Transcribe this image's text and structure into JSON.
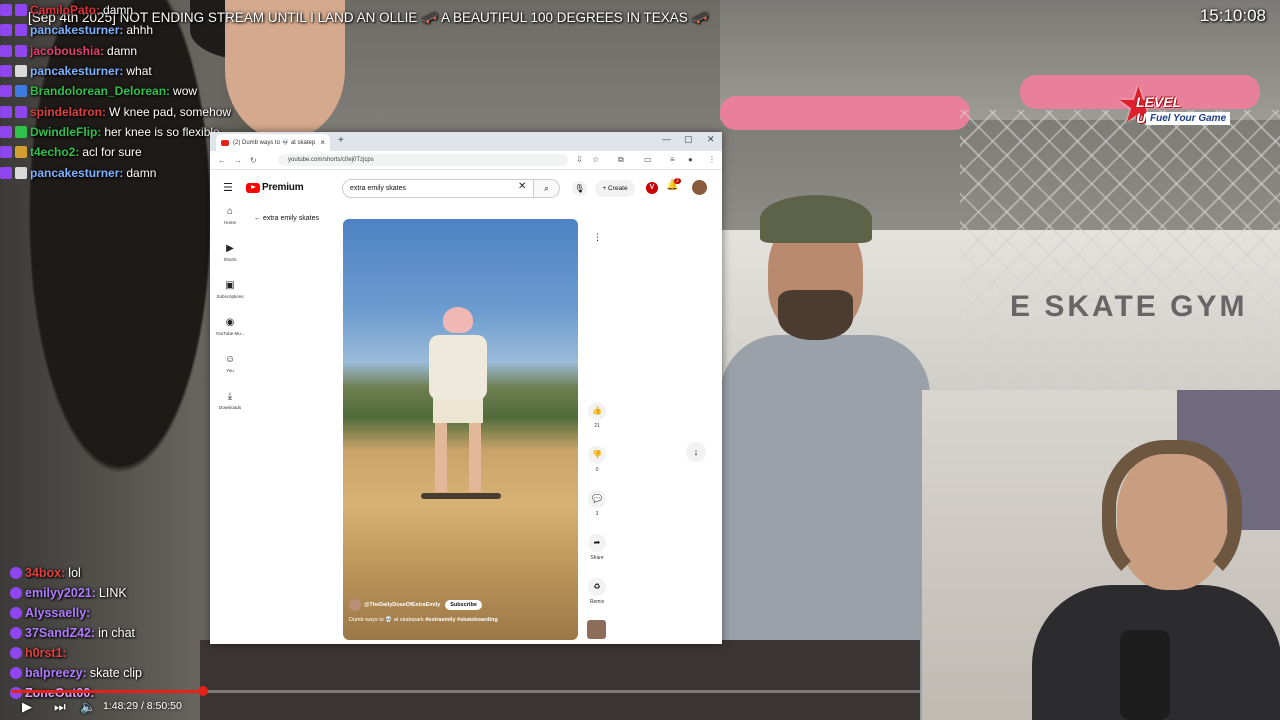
{
  "stream": {
    "title": "[Sep 4th 2025] NOT ENDING STREAM UNTIL I LAND AN OLLIE 🛹 A BEAUTIFUL 100 DEGREES IN TEXAS 🛹",
    "clock": "15:10:08",
    "logo_line1": "LEVEL UNLOCKED",
    "logo_line2": "Fuel Your Game",
    "gym_sign": "E SKATE GYM"
  },
  "chat_top": [
    {
      "user": "CamiloPato:",
      "msg": "damn",
      "color": "#e0303a",
      "badge": "b-purple"
    },
    {
      "user": "pancakesturner:",
      "msg": "ahhh",
      "color": "#7fb2ff",
      "badge": "b-purple"
    },
    {
      "user": "jacoboushia:",
      "msg": "damn",
      "color": "#e04070",
      "badge": "b-purple"
    },
    {
      "user": "pancakesturner:",
      "msg": "what",
      "color": "#7fb2ff",
      "badge": "b-grey"
    },
    {
      "user": "Brandolorean_Delorean:",
      "msg": "wow",
      "color": "#2ec24a",
      "badge": "b-blue"
    },
    {
      "user": "spindelatron:",
      "msg": "W knee pad, somehow",
      "color": "#e04040",
      "badge": "b-purple"
    },
    {
      "user": "DwindleFlip:",
      "msg": "her knee is so flexible",
      "color": "#2ec24a",
      "badge": "b-green"
    },
    {
      "user": "t4echo2:",
      "msg": "acl for sure",
      "color": "#2ec24a",
      "badge": "b-gold"
    },
    {
      "user": "pancakesturner:",
      "msg": "damn",
      "color": "#7fb2ff",
      "badge": "b-grey"
    }
  ],
  "chat_bottom": [
    {
      "user": "34box:",
      "msg": "lol",
      "color": "#e04040"
    },
    {
      "user": "emilyy2021:",
      "msg": "LINK",
      "color": "#b07cff"
    },
    {
      "user": "Alyssaelly:",
      "msg": "",
      "color": "#b07cff"
    },
    {
      "user": "37SandZ42:",
      "msg": "in chat",
      "color": "#b07cff"
    },
    {
      "user": "h0rst1:",
      "msg": "",
      "color": "#e04040"
    },
    {
      "user": "balpreezy:",
      "msg": "skate clip",
      "color": "#b07cff"
    },
    {
      "user": "ZoneOut00:",
      "msg": "",
      "color": "#e0a0ff"
    }
  ],
  "player": {
    "time": "1:48:29 / 8:50:50",
    "progress": 0.21
  },
  "browser": {
    "tab_title": "(2) Dumb ways to 💀 at skatep",
    "url": "youtube.com/shorts/c0ej0Tzjcps",
    "logo": "Premium",
    "search_value": "extra emily skates",
    "create_label": "Create",
    "avatar_letter": "V",
    "notif_count": "2",
    "back_label": "extra emily skates",
    "sidenav": [
      {
        "icon": "⌂",
        "label": "Home"
      },
      {
        "icon": "▶",
        "label": "Shorts"
      },
      {
        "icon": "▣",
        "label": "Subscriptions"
      },
      {
        "icon": "◉",
        "label": "YouTube Mu..."
      },
      {
        "icon": "☺",
        "label": "You"
      },
      {
        "icon": "⤓",
        "label": "Downloads"
      }
    ],
    "video": {
      "channel": "@TheDailyDoseOfExtraEmily",
      "subscribe": "Subscribe",
      "title": "Dumb ways to 💀 at skatepark",
      "tags": "#extraemily #skateboarding"
    },
    "actions": [
      {
        "icon": "👍",
        "label": "21"
      },
      {
        "icon": "👎",
        "label": "0"
      },
      {
        "icon": "💬",
        "label": "3"
      },
      {
        "icon": "➦",
        "label": "Share"
      },
      {
        "icon": "♻",
        "label": "Remix"
      }
    ]
  }
}
